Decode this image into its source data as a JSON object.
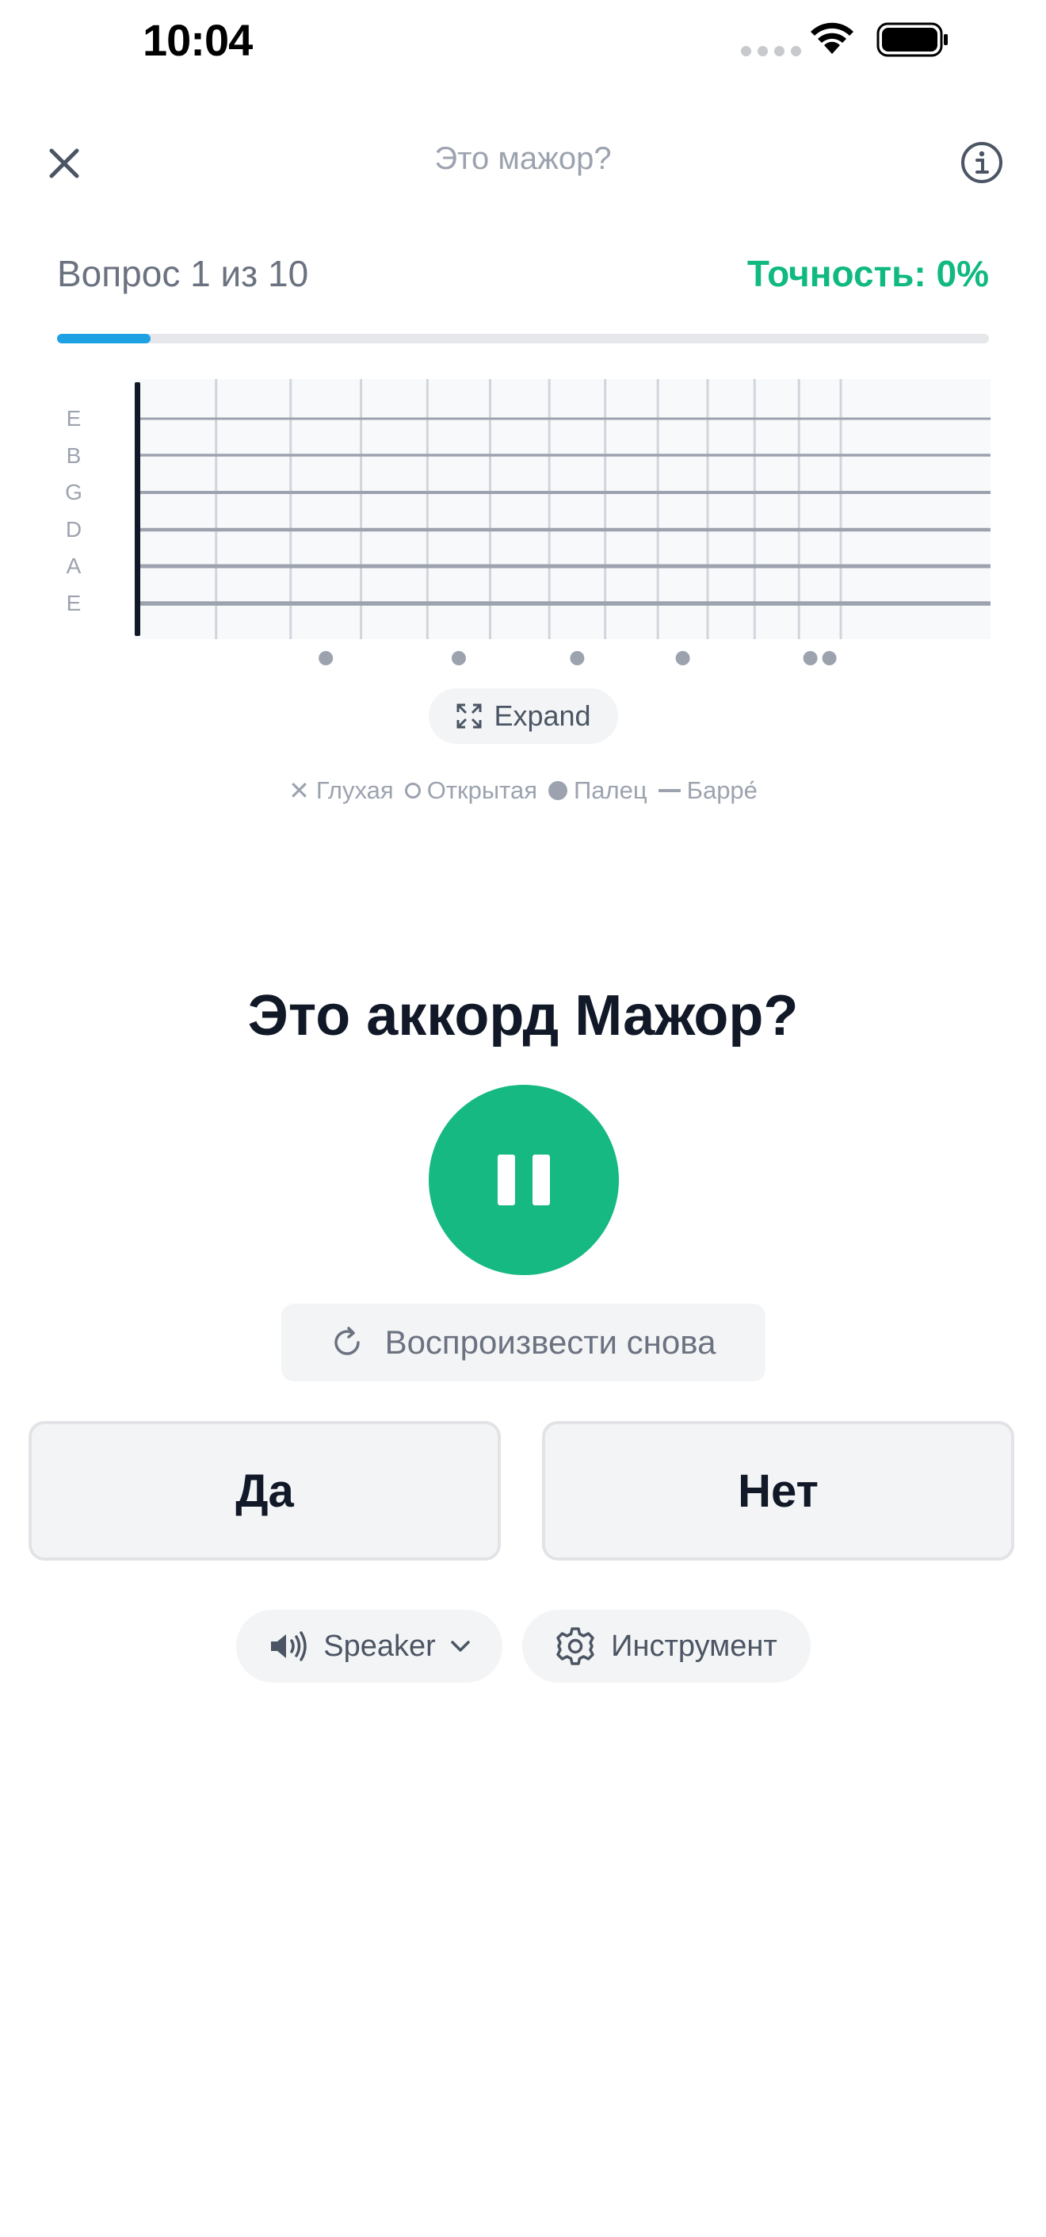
{
  "status_bar": {
    "time": "10:04"
  },
  "header": {
    "title": "Это мажор?",
    "close_icon": "close-icon",
    "info_icon": "info-icon"
  },
  "progress": {
    "question_label": "Вопрос 1 из 10",
    "accuracy_label": "Точность: 0%",
    "completion_fraction": 0.1,
    "accent_color": "#1da1e2"
  },
  "fretboard": {
    "string_labels": [
      "E",
      "B",
      "G",
      "D",
      "A",
      "E"
    ],
    "fret_count": 12,
    "marker_frets": [
      3,
      5,
      7,
      9,
      12
    ]
  },
  "expand_button": {
    "label": "Expand",
    "icon": "expand-icon"
  },
  "legend": {
    "muted": "Глухая",
    "open": "Открытая",
    "finger": "Палец",
    "barre": "Барре́"
  },
  "question": {
    "text": "Это аккорд Мажор?"
  },
  "play_button": {
    "icon": "pause-icon",
    "color": "#16b981"
  },
  "replay_button": {
    "label": "Воспроизвести снова",
    "icon": "replay-icon"
  },
  "answers": {
    "yes": "Да",
    "no": "Нет"
  },
  "controls": {
    "speaker_label": "Speaker",
    "speaker_icon": "speaker-icon",
    "instrument_label": "Инструмент",
    "instrument_icon": "gear-icon"
  },
  "colors": {
    "success": "#10b981",
    "muted_text": "#6b7280"
  }
}
